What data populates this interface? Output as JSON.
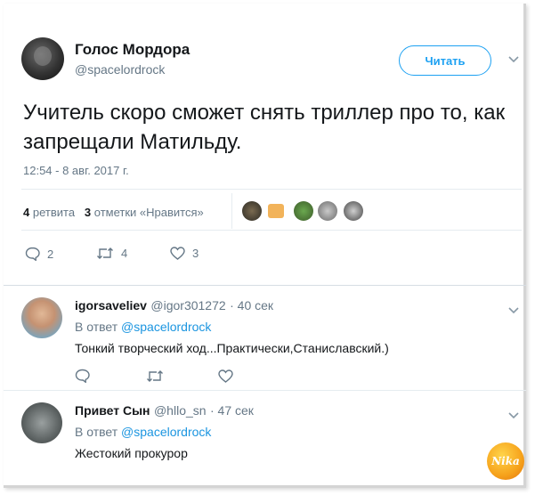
{
  "tweet": {
    "author_name": "Голос Мордора",
    "author_handle": "@spacelordrock",
    "follow_label": "Читать",
    "text": "Учитель скоро сможет снять триллер про то, как запрещали Матильду.",
    "timestamp": "12:54 - 8 авг. 2017 г.",
    "retweets_count": "4",
    "retweets_label": "ретвита",
    "likes_count": "3",
    "likes_label": "отметки «Нравится»",
    "actions": {
      "reply_count": "2",
      "retweet_count": "4",
      "like_count": "3"
    }
  },
  "replies": [
    {
      "name": "igorsaveliev",
      "handle": "@igor301272",
      "time": "· 40 сек",
      "reply_to_prefix": "В ответ",
      "reply_to": "@spacelordrock",
      "text": "Тонкий творческий ход...Практически,Станиславский.)"
    },
    {
      "name": "Привет Сын",
      "handle": "@hllo_sn",
      "time": "· 47 сек",
      "reply_to_prefix": "В ответ",
      "reply_to": "@spacelordrock",
      "text": "Жестокий прокурор"
    }
  ],
  "icons": {
    "caret": "chevron-down-icon",
    "reply": "reply-icon",
    "retweet": "retweet-icon",
    "like": "heart-icon"
  },
  "watermark_text": "Nika",
  "colors": {
    "accent": "#1da1f2",
    "link": "#1b95e0",
    "muted": "#657786",
    "text": "#14171a",
    "divider": "#e6ecf0"
  }
}
